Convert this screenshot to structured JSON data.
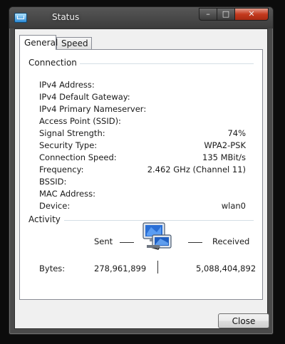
{
  "window": {
    "title": "Status",
    "controls": {
      "minimize": "–",
      "maximize": "□",
      "close": "✕"
    }
  },
  "tabs": [
    {
      "label": "General",
      "active": true
    },
    {
      "label": "Speed",
      "active": false
    }
  ],
  "connection": {
    "heading": "Connection",
    "rows": [
      {
        "label": "IPv4 Address:",
        "value": ""
      },
      {
        "label": "IPv4 Default Gateway:",
        "value": ""
      },
      {
        "label": "IPv4 Primary Nameserver:",
        "value": ""
      },
      {
        "label": "Access Point (SSID):",
        "value": ""
      },
      {
        "label": "Signal Strength:",
        "value": "74%"
      },
      {
        "label": "Security Type:",
        "value": "WPA2-PSK"
      },
      {
        "label": "Connection Speed:",
        "value": "135 MBit/s"
      },
      {
        "label": "Frequency:",
        "value": "2.462 GHz (Channel 11)"
      },
      {
        "label": "BSSID:",
        "value": ""
      },
      {
        "label": "MAC Address:",
        "value": ""
      },
      {
        "label": "Device:",
        "value": "wlan0"
      }
    ]
  },
  "activity": {
    "heading": "Activity",
    "sent_label": "Sent",
    "received_label": "Received",
    "bytes_label": "Bytes:",
    "bytes_sent": "278,961,899",
    "bytes_received": "5,088,404,892",
    "icon": "network-computers-icon"
  },
  "buttons": {
    "close": "Close"
  },
  "colors": {
    "titlebar": "#4a4a4a",
    "close_control": "#c43a1e",
    "panel_border": "#898c95"
  }
}
